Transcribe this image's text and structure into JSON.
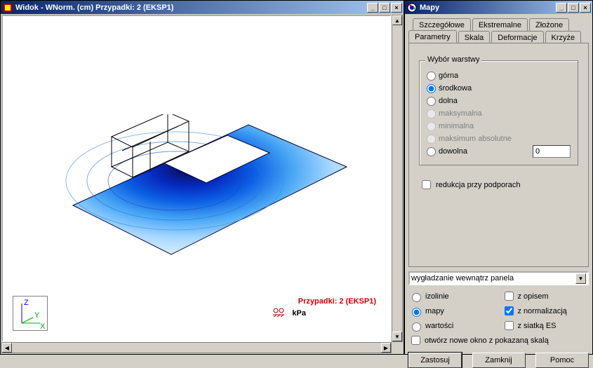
{
  "left_window": {
    "title": "Widok - WNorm. (cm) Przypadki: 2 (EKSP1)",
    "case_label": "Przypadki: 2 (EKSP1)",
    "unit_label": "kPa",
    "axes": {
      "z": "Z",
      "y": "Y",
      "x": "X"
    }
  },
  "right_window": {
    "title": "Mapy",
    "tabs_back": [
      "Szczegółowe",
      "Ekstremalne",
      "Złożone"
    ],
    "tabs_front": [
      "Parametry",
      "Skala",
      "Deformacje",
      "Krzyże"
    ],
    "group_legend": "Wybór warstwy",
    "radios": {
      "gorna": "górna",
      "srodkowa": "środkowa",
      "dolna": "dolna",
      "maksymalna": "maksymalna",
      "minimalna": "minimalna",
      "maks_abs": "maksimum absolutne",
      "dowolna": "dowolna"
    },
    "dowolna_value": "0",
    "reduction_label": "redukcja przy podporach",
    "combo_value": "wygładzanie wewnątrz panela",
    "display_opts": {
      "izolinie": "izolinie",
      "z_opisem": "z opisem",
      "mapy": "mapy",
      "z_norm": "z normalizacją",
      "wartosci": "wartości",
      "z_siatka": "z siatką ES",
      "otworz": "otwórz nowe okno z pokazaną skalą"
    },
    "buttons": {
      "apply": "Zastosuj",
      "close": "Zamknij",
      "help": "Pomoc"
    }
  }
}
